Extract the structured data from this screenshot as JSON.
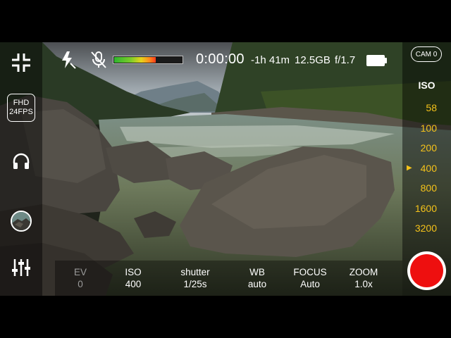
{
  "status": {
    "timer": "0:00:00",
    "remaining": "-1h 41m",
    "storage": "12.5GB",
    "aperture": "f/1.7",
    "audio_level": 0.6,
    "battery_level": 1.0
  },
  "icons": {
    "flash": "flash-auto-icon",
    "mic": "mic-off-icon",
    "collapse": "collapse-icon",
    "headphones": "headphones-icon",
    "sliders": "settings-sliders-icon"
  },
  "left_panel": {
    "resolution": "FHD",
    "framerate": "24FPS"
  },
  "right_panel": {
    "camera_label": "CAM 0",
    "iso_title": "ISO",
    "iso_values": [
      "58",
      "100",
      "200",
      "400",
      "800",
      "1600",
      "3200"
    ],
    "iso_selected": "400"
  },
  "params": [
    {
      "label": "EV",
      "value": "0",
      "enabled": false
    },
    {
      "label": "ISO",
      "value": "400",
      "enabled": true
    },
    {
      "label": "shutter",
      "value": "1/25s",
      "enabled": true
    },
    {
      "label": "WB",
      "value": "auto",
      "enabled": true
    },
    {
      "label": "FOCUS",
      "value": "Auto",
      "enabled": true
    },
    {
      "label": "ZOOM",
      "value": "1.0x",
      "enabled": true
    }
  ],
  "colors": {
    "accent": "#f4c21a",
    "record": "#ee0f0f"
  }
}
